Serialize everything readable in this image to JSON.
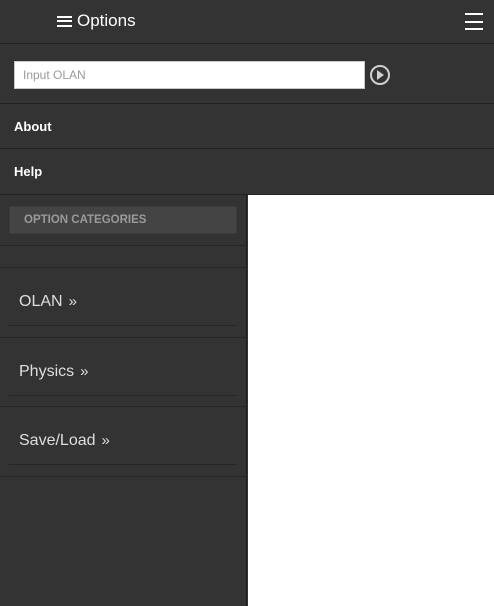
{
  "header": {
    "title": "Options",
    "title_icon": "list-icon",
    "menu_icon": "hamburger-menu-icon"
  },
  "olan_input": {
    "placeholder": "Input OLAN",
    "value": "",
    "submit_icon": "play-circle-icon"
  },
  "menu": {
    "about": "About",
    "help": "Help"
  },
  "sidebar": {
    "header": "OPTION CATEGORIES",
    "items": [
      {
        "label": "OLAN",
        "arrow": "»"
      },
      {
        "label": "Physics",
        "arrow": "»"
      },
      {
        "label": "Save/Load",
        "arrow": "»"
      }
    ]
  },
  "colors": {
    "panel_bg": "#333333",
    "content_bg": "#ffffff",
    "text": "#ffffff"
  }
}
